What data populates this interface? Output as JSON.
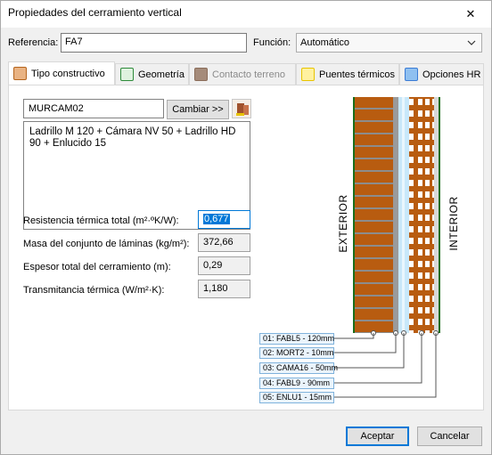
{
  "window": {
    "title": "Propiedades del cerramiento vertical",
    "close_glyph": "✕"
  },
  "referencia": {
    "label": "Referencia:",
    "value": "FA7"
  },
  "funcion": {
    "label": "Función:",
    "value": "Automático"
  },
  "tabs": [
    {
      "label": "Tipo constructivo",
      "icon": "tipo-constructivo-icon",
      "color": "#b5651d",
      "active": true,
      "disabled": false
    },
    {
      "label": "Geometría",
      "icon": "geometria-icon",
      "color": "#2e8b3a",
      "active": false,
      "disabled": false
    },
    {
      "label": "Contacto terreno",
      "icon": "contacto-terreno-icon",
      "color": "#8b6d5a",
      "active": false,
      "disabled": true
    },
    {
      "label": "Puentes térmicos",
      "icon": "puentes-termicos-icon",
      "color": "#e8c400",
      "active": false,
      "disabled": false
    },
    {
      "label": "Opciones HR",
      "icon": "opciones-hr-icon",
      "color": "#3a7bd5",
      "active": false,
      "disabled": false
    }
  ],
  "tipo": {
    "code": "MURCAM02",
    "change_button": "Cambiar >>",
    "description": "Ladrillo M 120 + Cámara NV 50 + Ladrillo HD 90 + Enlucido 15"
  },
  "properties": [
    {
      "label": "Resistencia térmica total  (m²·ºK/W):",
      "value": "0,677",
      "editable": true
    },
    {
      "label": "Masa del conjunto de láminas (kg/m²):",
      "value": "372,66",
      "editable": false
    },
    {
      "label": "Espesor total del cerramiento (m):",
      "value": "0,29",
      "editable": false
    },
    {
      "label": "Transmitancia térmica (W/m²·K):",
      "value": "1,180",
      "editable": false
    }
  ],
  "diagram": {
    "exterior_label": "EXTERIOR",
    "interior_label": "INTERIOR",
    "brick_color": "#b85c10",
    "air_color": "#c8e8fa",
    "mortar_color": "#8c8c8c",
    "layers": [
      "01: FABL5 - 120mm",
      "02: MORT2 - 10mm",
      "03: CAMA16 - 50mm",
      "04: FABL9 - 90mm",
      "05: ENLU1 - 15mm"
    ]
  },
  "buttons": {
    "accept": "Aceptar",
    "cancel": "Cancelar"
  }
}
